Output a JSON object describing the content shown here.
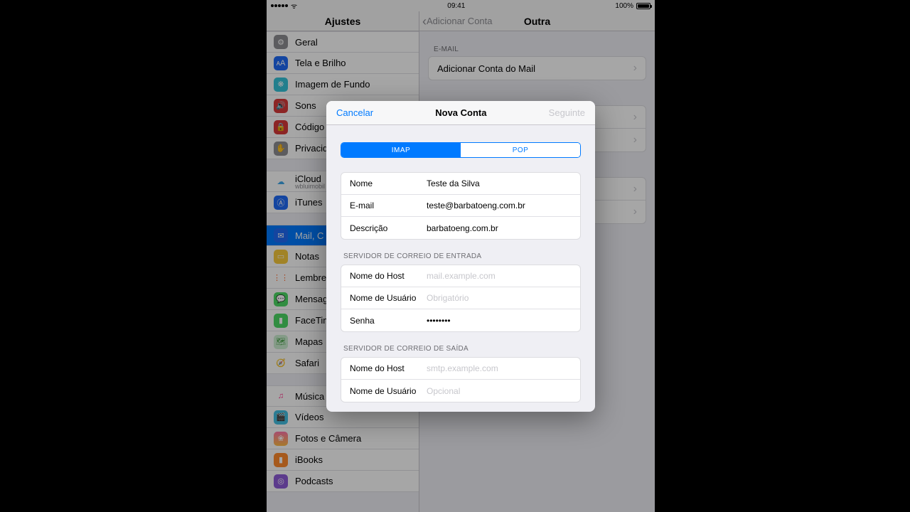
{
  "status": {
    "time": "09:41",
    "battery": "100%"
  },
  "nav": {
    "left_title": "Ajustes",
    "right_back": "Adicionar Conta",
    "right_title": "Outra"
  },
  "sidebar": {
    "g1": [
      {
        "icon": "⚙",
        "bg": "#8e8e93",
        "label": "Geral"
      },
      {
        "icon": "ᴀA",
        "bg": "#1f6af6",
        "label": "Tela e Brilho"
      },
      {
        "icon": "❋",
        "bg": "#35c3d9",
        "label": "Imagem de Fundo"
      },
      {
        "icon": "🔊",
        "bg": "#d83939",
        "label": "Sons"
      },
      {
        "icon": "🔒",
        "bg": "#d83939",
        "label": "Código"
      },
      {
        "icon": "✋",
        "bg": "#8e8e93",
        "label": "Privacidade"
      }
    ],
    "g2": [
      {
        "icon": "☁",
        "bg": "#ffffff",
        "fg": "#3ea7e8",
        "label": "iCloud",
        "sub": "wbluimobil"
      },
      {
        "icon": "Ⓐ",
        "bg": "#1f6af6",
        "label": "iTunes "
      }
    ],
    "g3": [
      {
        "icon": "✉",
        "bg": "#1f6af6",
        "label": "Mail, C",
        "selected": true
      },
      {
        "icon": "▭",
        "bg": "#f7c93c",
        "label": "Notas"
      },
      {
        "icon": "⋮⋮",
        "bg": "#ffffff",
        "fg": "#ff6a2d",
        "label": "Lembretes"
      },
      {
        "icon": "💬",
        "bg": "#4cd964",
        "label": "Mensagens"
      },
      {
        "icon": "▮",
        "bg": "#4cd964",
        "label": "FaceTime"
      },
      {
        "icon": "🗺",
        "bg": "#cdeed2",
        "fg": "#5a5",
        "label": "Mapas"
      },
      {
        "icon": "🧭",
        "bg": "#ffffff",
        "fg": "#1f6af6",
        "label": "Safari"
      }
    ],
    "g4": [
      {
        "icon": "♫",
        "bg": "#ffffff",
        "fg": "#ff2d89",
        "label": "Música"
      },
      {
        "icon": "🎬",
        "bg": "#43bfe2",
        "label": "Vídeos"
      },
      {
        "icon": "❀",
        "bg": "linear-gradient(#f7a,#fb4)",
        "label": "Fotos e Câmera"
      },
      {
        "icon": "▮",
        "bg": "#ff8a2d",
        "label": "iBooks"
      },
      {
        "icon": "◎",
        "bg": "#8e5bd8",
        "label": "Podcasts"
      }
    ]
  },
  "detail": {
    "section1": "E-MAIL",
    "row1": "Adicionar Conta do Mail"
  },
  "modal": {
    "cancel": "Cancelar",
    "title": "Nova Conta",
    "next": "Seguinte",
    "seg_imap": "IMAP",
    "seg_pop": "POP",
    "fields1": [
      {
        "label": "Nome",
        "value": "Teste da Silva"
      },
      {
        "label": "E-mail",
        "value": "teste@barbatoeng.com.br"
      },
      {
        "label": "Descrição",
        "value": "barbatoeng.com.br"
      }
    ],
    "header_in": "SERVIDOR DE CORREIO DE ENTRADA",
    "fields_in": [
      {
        "label": "Nome do Host",
        "placeholder": "mail.example.com"
      },
      {
        "label": "Nome de Usuário",
        "placeholder": "Obrigatório"
      },
      {
        "label": "Senha",
        "value": "••••••••"
      }
    ],
    "header_out": "SERVIDOR DE CORREIO DE SAÍDA",
    "fields_out": [
      {
        "label": "Nome do Host",
        "placeholder": "smtp.example.com"
      },
      {
        "label": "Nome de Usuário",
        "placeholder": "Opcional"
      }
    ]
  }
}
